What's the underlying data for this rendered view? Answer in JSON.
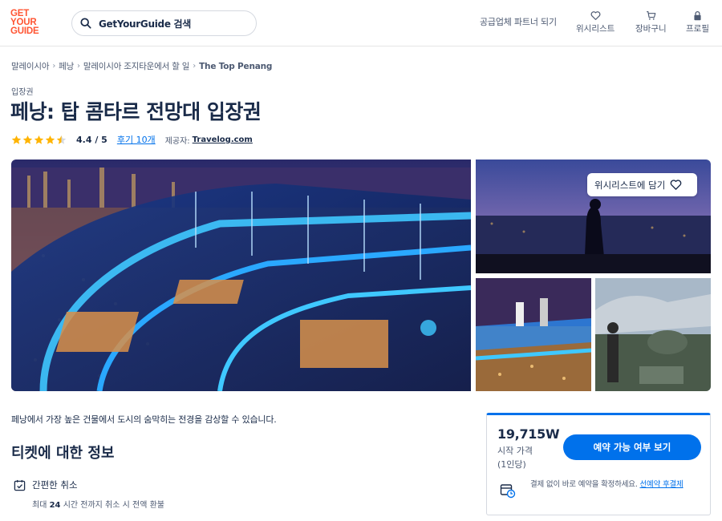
{
  "header": {
    "logo_lines": [
      "GET",
      "YOUR",
      "GUIDE"
    ],
    "search_placeholder": "GetYourGuide 검색",
    "partner_label": "공급업체 파트너 되기",
    "nav": {
      "wishlist": "위시리스트",
      "cart": "장바구니",
      "profile": "프로필"
    }
  },
  "breadcrumb": [
    "말레이시아",
    "페낭",
    "말레이시아 조지타운에서 할 일",
    "The Top Penang"
  ],
  "product": {
    "category": "입장권",
    "title": "페낭: 탑 콤타르 전망대 입장권",
    "rating": 4.4,
    "rating_text": "4.4 / 5",
    "reviews_label": "후기 10개",
    "provider_label": "제공자:",
    "provider_name": "Travelog.com"
  },
  "gallery": {
    "wishlist_button": "위시리스트에 담기"
  },
  "details": {
    "description": "페낭에서 가장 높은 건물에서 도시의 숨막히는 전경을 감상할 수 있습니다.",
    "section_title": "티켓에 대한 정보",
    "feature_title": "간편한 취소",
    "feature_sub_prefix": "최대",
    "feature_sub_bold": "24",
    "feature_sub_suffix": "시간 전까지 취소 시 전액 환불"
  },
  "booking": {
    "price": "19,715W",
    "price_label": "시작 가격",
    "price_unit": "(1인당)",
    "check_button": "예약 가능 여부 보기",
    "note_text": "결제 없이 바로 예약을 확정하세요.",
    "note_link": "선예약 후결제"
  },
  "colors": {
    "brand": "#ff5533",
    "accent_blue": "#0071eb",
    "star": "#ffb400",
    "text_dark": "#1a2b49"
  }
}
